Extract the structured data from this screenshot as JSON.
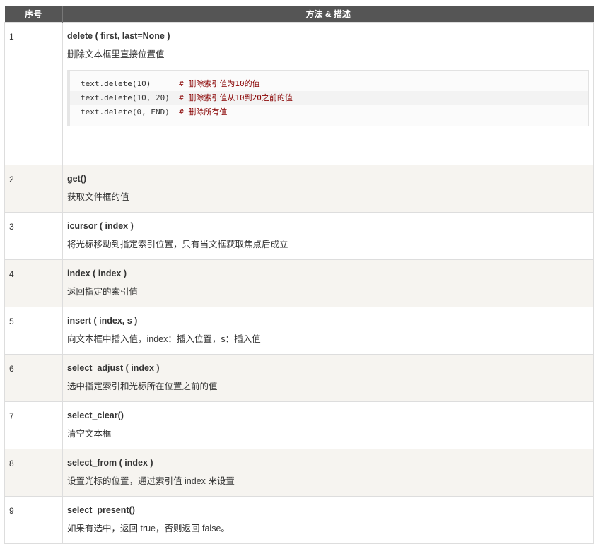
{
  "header": {
    "col_num": "序号",
    "col_method": "方法 & 描述"
  },
  "rows": [
    {
      "num": "1",
      "name": "delete ( first, last=None )",
      "desc": "删除文本框里直接位置值",
      "code": [
        {
          "code": "text.delete(10)      ",
          "comment": "# 删除索引值为10的值"
        },
        {
          "code": "text.delete(10, 20)  ",
          "comment": "# 删除索引值从10到20之前的值"
        },
        {
          "code": "text.delete(0, END)  ",
          "comment": "# 删除所有值"
        }
      ]
    },
    {
      "num": "2",
      "name": "get()",
      "desc": "获取文件框的值"
    },
    {
      "num": "3",
      "name": "icursor ( index )",
      "desc": "将光标移动到指定索引位置，只有当文框获取焦点后成立"
    },
    {
      "num": "4",
      "name": "index ( index )",
      "desc": "返回指定的索引值"
    },
    {
      "num": "5",
      "name": "insert ( index, s )",
      "desc": "向文本框中插入值，index：插入位置，s：插入值"
    },
    {
      "num": "6",
      "name": "select_adjust ( index )",
      "desc": "选中指定索引和光标所在位置之前的值"
    },
    {
      "num": "7",
      "name": "select_clear()",
      "desc": "清空文本框"
    },
    {
      "num": "8",
      "name": "select_from ( index )",
      "desc": "设置光标的位置，通过索引值 index 来设置"
    },
    {
      "num": "9",
      "name": "select_present()",
      "desc": "如果有选中，返回 true，否则返回 false。"
    }
  ]
}
